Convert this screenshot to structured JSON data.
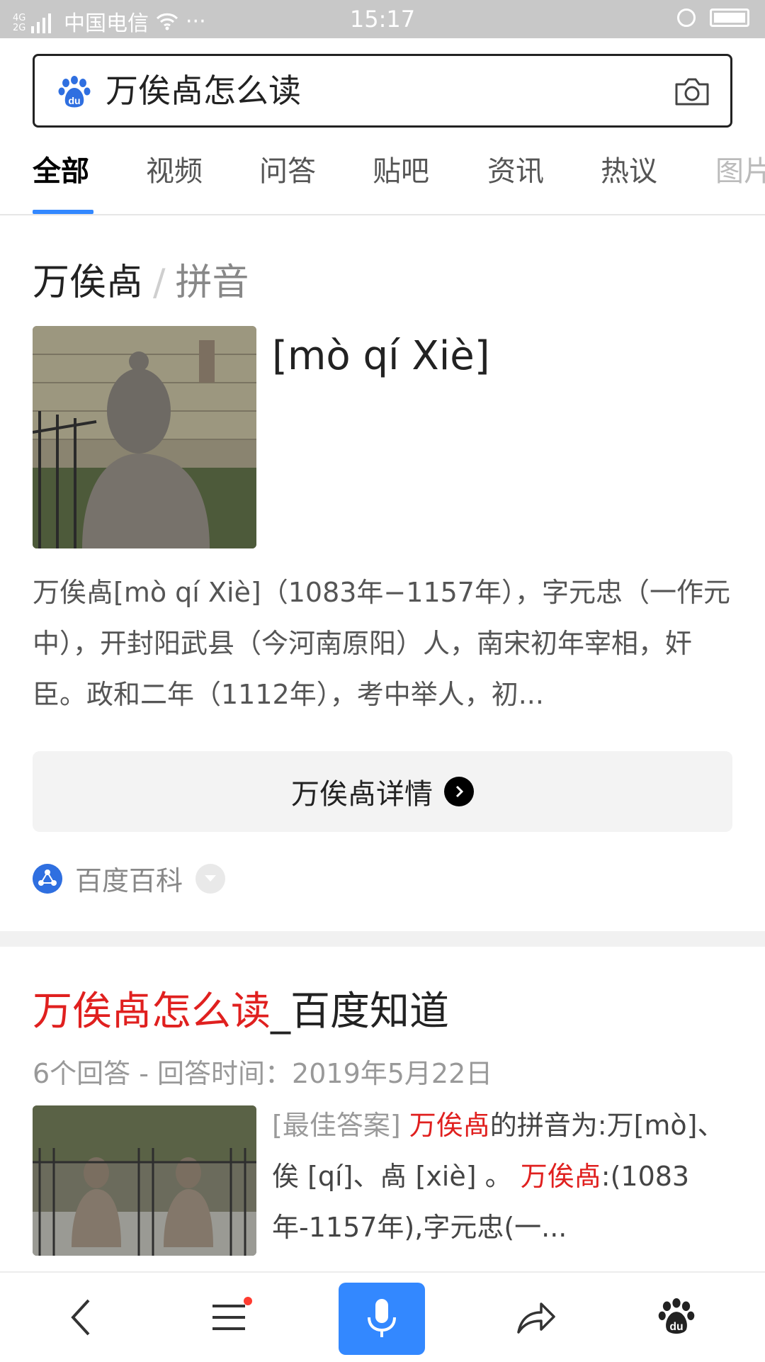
{
  "status_bar": {
    "network": "4G 2G",
    "carrier": "中国电信",
    "extra": "···",
    "time": "15:17"
  },
  "search": {
    "query": "万俟卨怎么读",
    "logo_icon": "baidu-paw-icon",
    "camera_icon": "camera-icon"
  },
  "tabs": [
    "全部",
    "视频",
    "问答",
    "贴吧",
    "资讯",
    "热议",
    "图片"
  ],
  "active_tab_index": 0,
  "card1": {
    "title": "万俟卨",
    "separator": "/",
    "subtitle": "拼音",
    "pinyin": "[mò qí Xiè]",
    "description": "万俟卨[mò qí Xiè]（1083年−1157年），字元忠（一作元中），开封阳武县（今河南原阳）人，南宋初年宰相，奸臣。政和二年（1112年），考中举人，初...",
    "details_button": "万俟卨详情",
    "source": "百度百科"
  },
  "card2": {
    "title_highlight": "万俟卨怎么读",
    "title_rest": "_百度知道",
    "meta": "6个回答 - 回答时间：2019年5月22日",
    "answer": {
      "tag": "[最佳答案]",
      "hl1": "万俟卨",
      "text1": "的拼音为:万[mò]、俟 [qí]、卨 [xiè] 。",
      "hl2": "万俟卨",
      "text2": ":(1083年-1157年),字元忠(一..."
    }
  },
  "bottom_nav": {
    "back_icon": "back-arrow-icon",
    "menu_icon": "menu-icon",
    "mic_icon": "microphone-icon",
    "share_icon": "share-icon",
    "home_icon": "baidu-paw-icon"
  },
  "colors": {
    "accent_blue": "#3388ff",
    "highlight_red": "#e0201f",
    "status_bar_bg": "#c8c8c8"
  }
}
